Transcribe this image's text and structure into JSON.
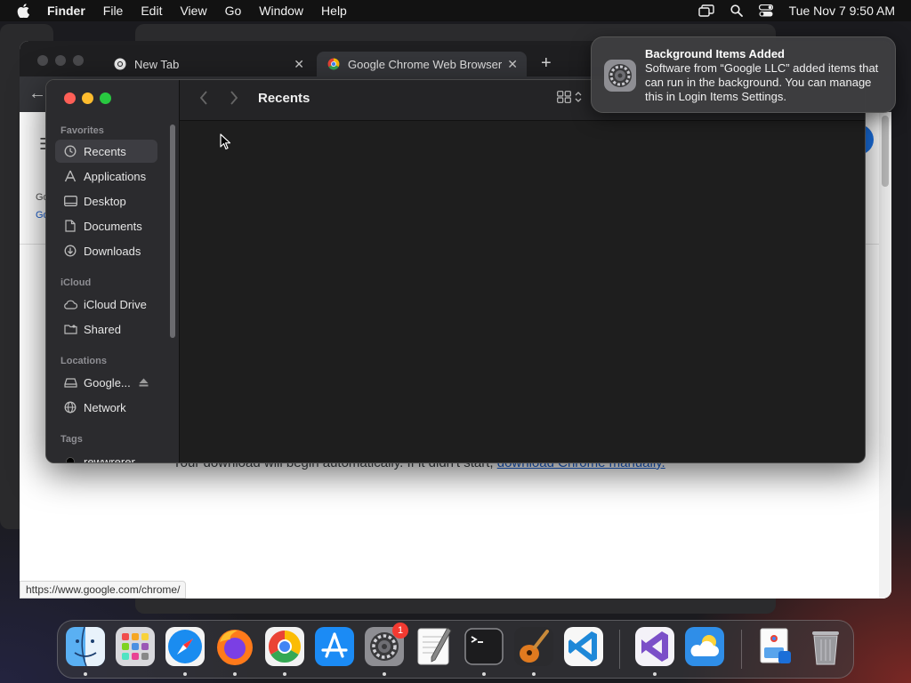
{
  "menubar": {
    "app_name": "Finder",
    "items": [
      "File",
      "Edit",
      "View",
      "Go",
      "Window",
      "Help"
    ],
    "clock": "Tue Nov 7  9:50 AM"
  },
  "chrome": {
    "tabs": [
      {
        "label": "New Tab",
        "icon": "chrome-icon"
      },
      {
        "label": "Google Chrome Web Browser",
        "icon": "chrome-icon"
      }
    ],
    "new_tab_label": "+",
    "page": {
      "line1": "Go",
      "line2": "Go",
      "download_text": "Your download will begin automatically. If it didn't start, ",
      "download_link": "download Chrome manually."
    },
    "status_url": "https://www.google.com/chrome/"
  },
  "finder": {
    "title": "Recents",
    "sidebar": {
      "favorites_header": "Favorites",
      "favorites": [
        {
          "label": "Recents",
          "icon": "clock-icon",
          "selected": true
        },
        {
          "label": "Applications",
          "icon": "applications-icon"
        },
        {
          "label": "Desktop",
          "icon": "desktop-icon"
        },
        {
          "label": "Documents",
          "icon": "document-icon"
        },
        {
          "label": "Downloads",
          "icon": "downloads-icon"
        }
      ],
      "icloud_header": "iCloud",
      "icloud": [
        {
          "label": "iCloud Drive",
          "icon": "cloud-icon"
        },
        {
          "label": "Shared",
          "icon": "shared-folder-icon"
        }
      ],
      "locations_header": "Locations",
      "locations": [
        {
          "label": "Google...",
          "icon": "drive-icon"
        },
        {
          "label": "Network",
          "icon": "network-icon"
        }
      ],
      "tags_header": "Tags",
      "tags": [
        {
          "label": "rewwrerer",
          "color": "#000000"
        }
      ]
    }
  },
  "notification": {
    "title": "Background Items Added",
    "body": "Software from “Google LLC” added items that can run in the background. You can manage this in Login Items Settings."
  },
  "dock": {
    "apps": [
      {
        "name": "finder"
      },
      {
        "name": "launchpad"
      },
      {
        "name": "safari"
      },
      {
        "name": "firefox"
      },
      {
        "name": "chrome"
      },
      {
        "name": "app-store"
      },
      {
        "name": "system-settings",
        "badge": "1"
      },
      {
        "name": "textedit"
      },
      {
        "name": "terminal"
      },
      {
        "name": "garageband"
      },
      {
        "name": "vscode"
      },
      {
        "name": "visual-studio"
      },
      {
        "name": "weather"
      },
      {
        "name": "preview-document"
      },
      {
        "name": "trash"
      }
    ]
  }
}
